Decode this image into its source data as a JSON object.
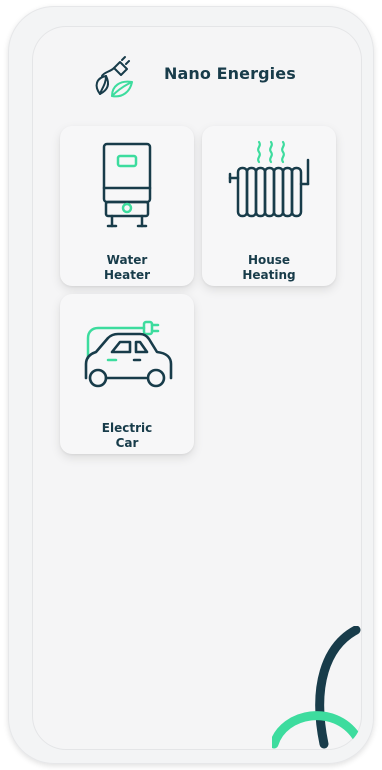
{
  "app": {
    "brand_name": "Nano Energies",
    "logo_icon": "plug-leaf-icon"
  },
  "tiles": [
    {
      "line1": "Water",
      "line2": "Heater",
      "icon": "water-heater-icon"
    },
    {
      "line1": "House",
      "line2": "Heating",
      "icon": "radiator-icon"
    },
    {
      "line1": "Electric",
      "line2": "Car",
      "icon": "electric-car-icon"
    }
  ],
  "colors": {
    "primary_dark": "#183c4a",
    "accent_green": "#3ddc9e",
    "background": "#f5f5f6"
  }
}
